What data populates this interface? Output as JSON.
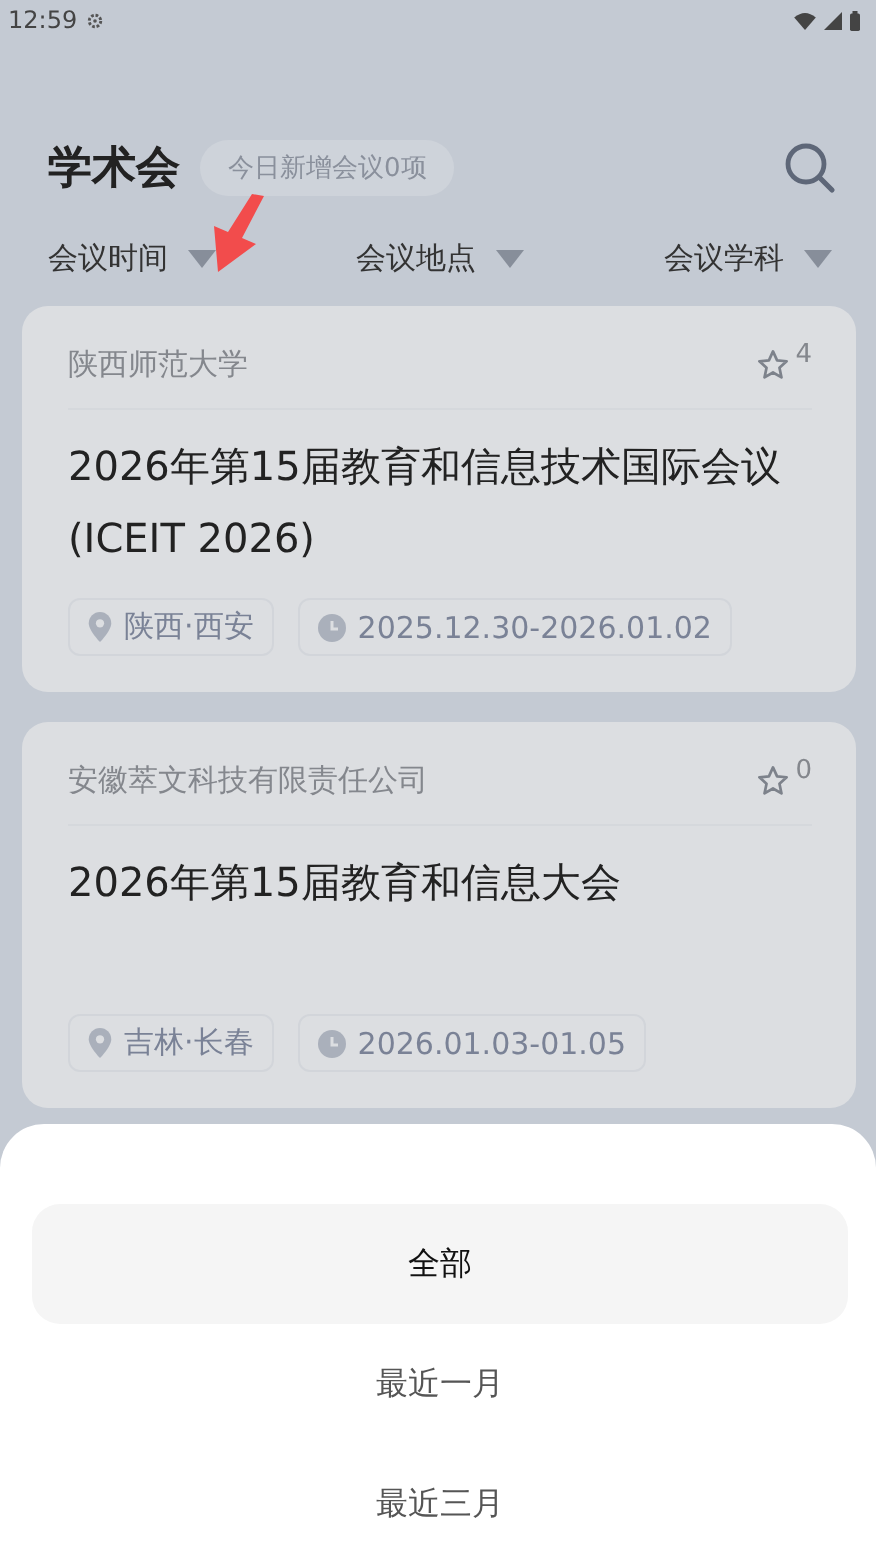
{
  "status_bar": {
    "time": "12:59"
  },
  "header": {
    "title": "学术会",
    "badge": "今日新增会议0项"
  },
  "filters": [
    {
      "label": "会议时间"
    },
    {
      "label": "会议地点"
    },
    {
      "label": "会议学科"
    }
  ],
  "conferences": [
    {
      "organizer": "陕西师范大学",
      "favorites": "4",
      "title": "2026年第15届教育和信息技术国际会议(ICEIT 2026)",
      "location": "陕西·西安",
      "dates": "2025.12.30-2026.01.02"
    },
    {
      "organizer": "安徽萃文科技有限责任公司",
      "favorites": "0",
      "title": "2026年第15届教育和信息大会",
      "location": "吉林·长春",
      "dates": "2026.01.03-01.05"
    }
  ],
  "sheet": {
    "options": [
      {
        "label": "全部",
        "selected": true
      },
      {
        "label": "最近一月",
        "selected": false
      },
      {
        "label": "最近三月",
        "selected": false
      }
    ]
  }
}
